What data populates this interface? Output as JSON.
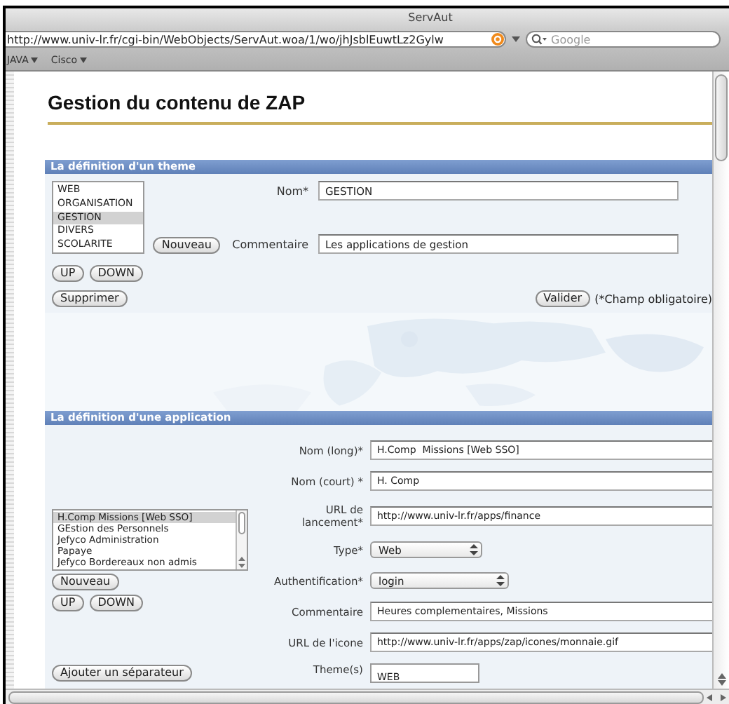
{
  "window": {
    "title": "ServAut"
  },
  "address_bar": {
    "url": "http://www.univ-lr.fr/cgi-bin/WebObjects/ServAut.woa/1/wo/jhJsblEuwtLz2Gylw"
  },
  "search": {
    "placeholder": "Google"
  },
  "bookmarks": [
    {
      "label": "JAVA"
    },
    {
      "label": "Cisco"
    }
  ],
  "page_title": "Gestion du contenu de ZAP",
  "theme_section": {
    "header": "La définition d'un theme",
    "themes": [
      {
        "label": "WEB",
        "selected": false
      },
      {
        "label": "ORGANISATION",
        "selected": false
      },
      {
        "label": "GESTION",
        "selected": true
      },
      {
        "label": "DIVERS",
        "selected": false
      },
      {
        "label": "SCOLARITE",
        "selected": false
      }
    ],
    "new_button": "Nouveau",
    "up_button": "UP",
    "down_button": "DOWN",
    "delete_button": "Supprimer",
    "fields": [
      {
        "label": "Nom*",
        "value": "GESTION"
      },
      {
        "label": "Commentaire",
        "value": "Les applications de gestion"
      }
    ],
    "submit_button": "Valider",
    "required_note": "(*Champ obligatoire)"
  },
  "application_section": {
    "header": "La définition d'une application",
    "applications": [
      {
        "label": "H.Comp Missions [Web SSO]",
        "selected": true
      },
      {
        "label": "GEstion des Personnels",
        "selected": false
      },
      {
        "label": "Jefyco Administration",
        "selected": false
      },
      {
        "label": "Papaye",
        "selected": false
      },
      {
        "label": "Jefyco Bordereaux non admis",
        "selected": false
      }
    ],
    "new_button": "Nouveau",
    "up_button": "UP",
    "down_button": "DOWN",
    "separator_button": "Ajouter un séparateur",
    "fields": [
      {
        "kind": "text",
        "label": "Nom (long)*",
        "value": "H.Comp  Missions [Web SSO]"
      },
      {
        "kind": "text",
        "label": "Nom (court) *",
        "value": "H. Comp"
      },
      {
        "kind": "text",
        "label": "URL de lancement*",
        "value": "http://www.univ-lr.fr/apps/finance"
      },
      {
        "kind": "select",
        "label": "Type*",
        "value": "Web"
      },
      {
        "kind": "select",
        "label": "Authentification*",
        "value": "login"
      },
      {
        "kind": "text",
        "label": "Commentaire",
        "value": "Heures complementaires, Missions"
      },
      {
        "kind": "text",
        "label": "URL de l'icone",
        "value": "http://www.univ-lr.fr/apps/zap/icones/monnaie.gif"
      },
      {
        "kind": "list",
        "label": "Theme(s)",
        "value": "WEB"
      }
    ]
  }
}
